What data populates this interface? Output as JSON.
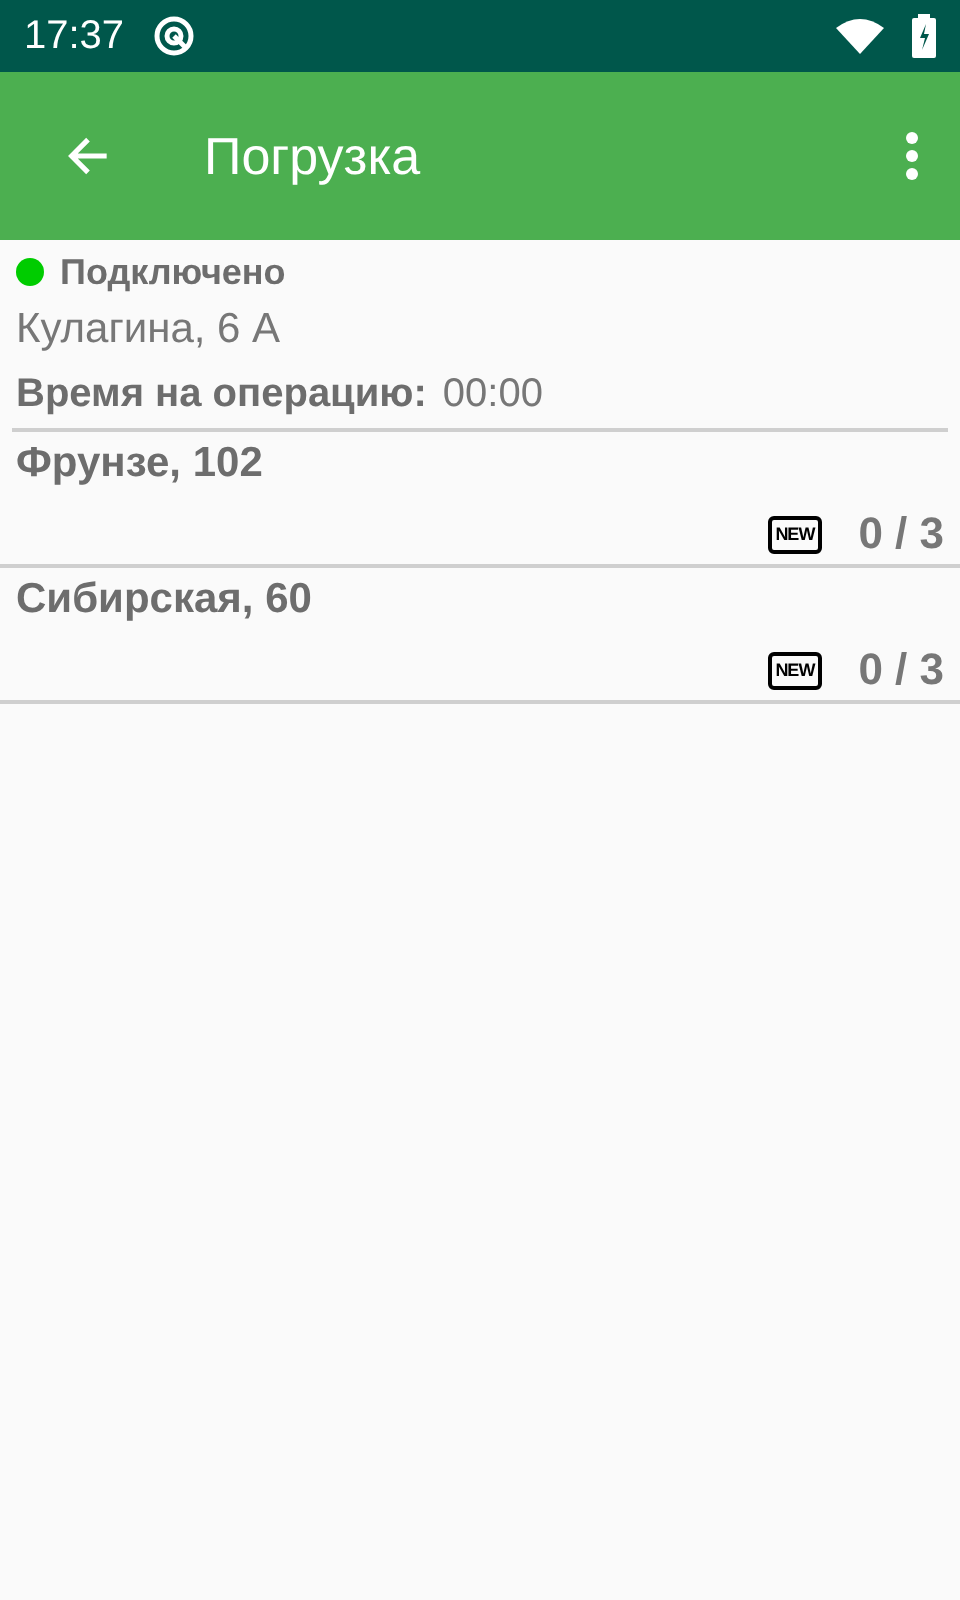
{
  "status_bar": {
    "time": "17:37"
  },
  "app_bar": {
    "title": "Погрузка"
  },
  "connection": {
    "label": "Подключено",
    "color": "#00cc00"
  },
  "address": "Кулагина, 6 А",
  "operation_time": {
    "label": "Время на операцию:",
    "value": "00:00"
  },
  "stops": [
    {
      "name": "Фрунзе, 102",
      "badge": "NEW",
      "count": "0 / 3"
    },
    {
      "name": "Сибирская, 60",
      "badge": "NEW",
      "count": "0 / 3"
    }
  ]
}
